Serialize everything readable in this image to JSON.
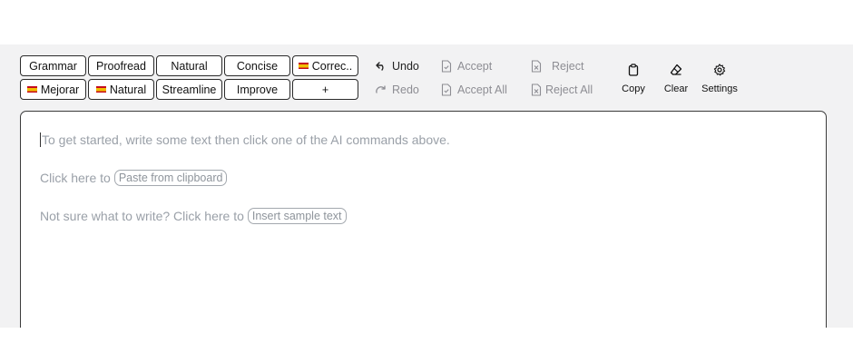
{
  "commands": {
    "row1": [
      "Grammar",
      "Proofread",
      "Natural",
      "Concise",
      "Correc.."
    ],
    "row2": [
      "Mejorar",
      "Natural",
      "Streamline",
      "Improve",
      "+"
    ]
  },
  "actions": {
    "undo": "Undo",
    "redo": "Redo",
    "accept": "Accept",
    "accept_all": "Accept All",
    "reject": "Reject",
    "reject_all": "Reject All"
  },
  "tools": {
    "copy": "Copy",
    "clear": "Clear",
    "settings": "Settings"
  },
  "editor": {
    "placeholder": "To get started, write some text then click one of the AI commands above.",
    "paste_prefix": "Click here to",
    "paste_button": "Paste from clipboard",
    "sample_prefix": "Not sure what to write? Click here to",
    "sample_button": "Insert sample text"
  },
  "icons": {
    "undo": "undo-arrow-icon",
    "redo": "redo-arrow-icon",
    "accept": "document-check-icon",
    "reject": "document-x-icon",
    "copy": "clipboard-icon",
    "clear": "eraser-icon",
    "settings": "gear-icon",
    "flag": "spanish-flag-icon"
  },
  "colors": {
    "toolbar_bg": "#f2f2f3",
    "active_text": "#222222",
    "disabled_text": "#8d8d93",
    "placeholder_text": "#9aa0a8"
  }
}
